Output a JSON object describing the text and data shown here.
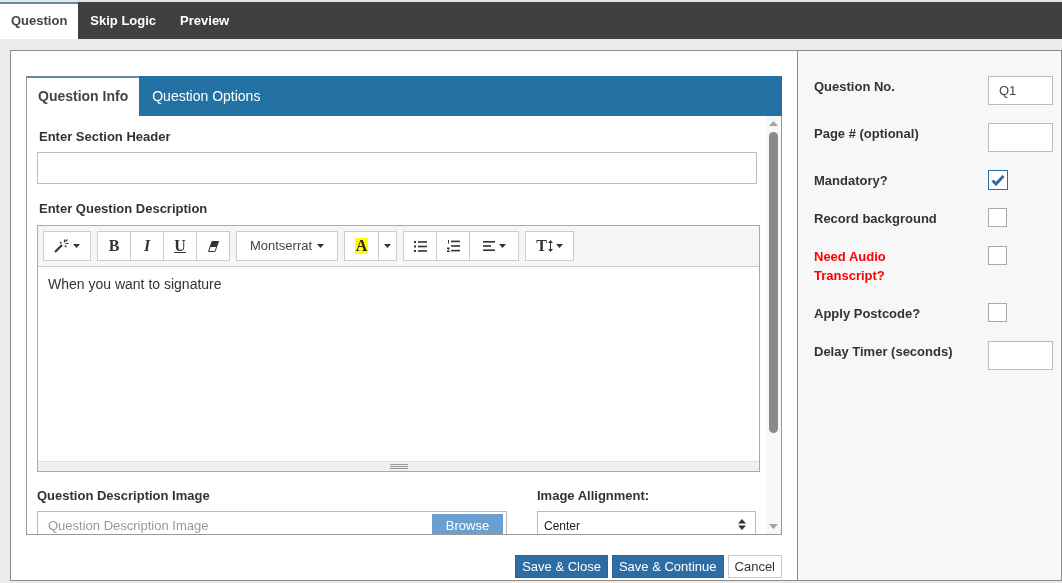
{
  "top_tabs": [
    {
      "label": "Question",
      "selected": true
    },
    {
      "label": "Skip Logic",
      "selected": false
    },
    {
      "label": "Preview",
      "selected": false
    }
  ],
  "question_tabs": [
    {
      "label": "Question Info",
      "selected": true
    },
    {
      "label": "Question Options",
      "selected": false
    }
  ],
  "section_header": {
    "label": "Enter Section Header"
  },
  "description": {
    "label": "Enter Question Description",
    "toolbar": [
      [
        {
          "kind": "style"
        }
      ],
      [
        {
          "kind": "bold",
          "label": "B"
        },
        {
          "kind": "italic",
          "label": "I"
        },
        {
          "kind": "underline",
          "label": "U"
        },
        {
          "kind": "eraser"
        }
      ],
      [
        {
          "kind": "font",
          "label": "Montserrat"
        }
      ],
      [
        {
          "kind": "color",
          "label": "A"
        },
        {
          "kind": "color-menu"
        }
      ],
      [
        {
          "kind": "bullets"
        },
        {
          "kind": "numbers"
        },
        {
          "kind": "align"
        }
      ],
      [
        {
          "kind": "size",
          "label": "T"
        }
      ]
    ],
    "text": "When you want to signature"
  },
  "image": {
    "label": "Question Description Image",
    "placeholder": "Question Description Image",
    "button": "Browse"
  },
  "alignment": {
    "label": "Image Allignment:",
    "value": "Center"
  },
  "actions": [
    {
      "label": "Save & Close",
      "kind": "primary"
    },
    {
      "label": "Save & Continue",
      "kind": "primary"
    },
    {
      "label": "Cancel",
      "kind": "default"
    }
  ],
  "settings": [
    {
      "kind": "input",
      "label": "Question No.",
      "value": "Q1",
      "alert": false
    },
    {
      "kind": "input",
      "label": "Page # (optional)",
      "alert": false
    },
    {
      "kind": "checkbox",
      "label": "Mandatory?",
      "checked": true,
      "alert": false
    },
    {
      "kind": "checkbox",
      "label": "Record background",
      "checked": false,
      "alert": false
    },
    {
      "kind": "checkbox",
      "label": "Need Audio Transcript?",
      "checked": false,
      "alert": true
    },
    {
      "kind": "checkbox",
      "label": "Apply Postcode?",
      "checked": false,
      "alert": false
    },
    {
      "kind": "input",
      "label": "Delay Timer (seconds)",
      "alert": false
    }
  ]
}
